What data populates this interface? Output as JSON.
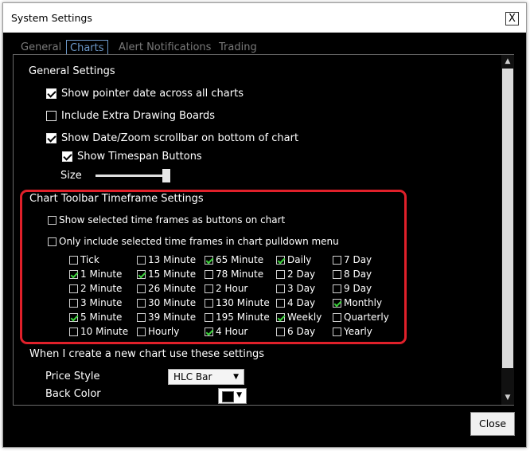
{
  "window": {
    "title": "System Settings",
    "close_glyph": "X"
  },
  "tabs": [
    {
      "label": "General",
      "active": false
    },
    {
      "label": "Charts",
      "active": true
    },
    {
      "label": "Alert Notifications",
      "active": false
    },
    {
      "label": "Trading",
      "active": false
    }
  ],
  "general": {
    "heading": "General Settings",
    "pointer_date": {
      "label": "Show pointer date across all charts",
      "checked": true
    },
    "extra_boards": {
      "label": "Include Extra Drawing Boards",
      "checked": false
    },
    "scrollbar": {
      "label": "Show Date/Zoom scrollbar on bottom of chart",
      "checked": true
    },
    "timespan": {
      "label": "Show Timespan Buttons",
      "checked": true
    },
    "size_label": "Size",
    "size_value": 0.95
  },
  "toolbar": {
    "heading": "Chart Toolbar Timeframe Settings",
    "as_buttons": {
      "label": "Show selected time frames as buttons on chart",
      "checked": false
    },
    "pulldown": {
      "label": "Only include selected time frames in chart pulldown menu",
      "checked": false
    },
    "columns": [
      [
        {
          "label": "Tick",
          "checked": false
        },
        {
          "label": "1 Minute",
          "checked": true
        },
        {
          "label": "2 Minute",
          "checked": false
        },
        {
          "label": "3 Minute",
          "checked": false
        },
        {
          "label": "5 Minute",
          "checked": true
        },
        {
          "label": "10 Minute",
          "checked": false
        }
      ],
      [
        {
          "label": "13 Minute",
          "checked": false
        },
        {
          "label": "15 Minute",
          "checked": true
        },
        {
          "label": "26 Minute",
          "checked": false
        },
        {
          "label": "30 Minute",
          "checked": false
        },
        {
          "label": "39 Minute",
          "checked": false
        },
        {
          "label": "Hourly",
          "checked": false
        }
      ],
      [
        {
          "label": "65 Minute",
          "checked": true
        },
        {
          "label": "78 Minute",
          "checked": false
        },
        {
          "label": "2 Hour",
          "checked": false
        },
        {
          "label": "130 Minute",
          "checked": false
        },
        {
          "label": "195 Minute",
          "checked": false
        },
        {
          "label": "4 Hour",
          "checked": true
        }
      ],
      [
        {
          "label": "Daily",
          "checked": true
        },
        {
          "label": "2 Day",
          "checked": false
        },
        {
          "label": "3 Day",
          "checked": false
        },
        {
          "label": "4 Day",
          "checked": false
        },
        {
          "label": "Weekly",
          "checked": true
        },
        {
          "label": "6 Day",
          "checked": false
        }
      ],
      [
        {
          "label": "7 Day",
          "checked": false
        },
        {
          "label": "8 Day",
          "checked": false
        },
        {
          "label": "9 Day",
          "checked": false
        },
        {
          "label": "Monthly",
          "checked": true
        },
        {
          "label": "Quarterly",
          "checked": false
        },
        {
          "label": "Yearly",
          "checked": false
        }
      ]
    ]
  },
  "new_chart": {
    "heading": "When I create a new chart use these settings",
    "price_style_label": "Price Style",
    "price_style_value": "HLC Bar",
    "back_color_label": "Back Color",
    "back_color_value": "#000000"
  },
  "buttons": {
    "close": "Close"
  },
  "colors": {
    "accent_tab": "#6c98c8",
    "highlight_border": "#e0202a",
    "check_green": "#3cd23c"
  }
}
